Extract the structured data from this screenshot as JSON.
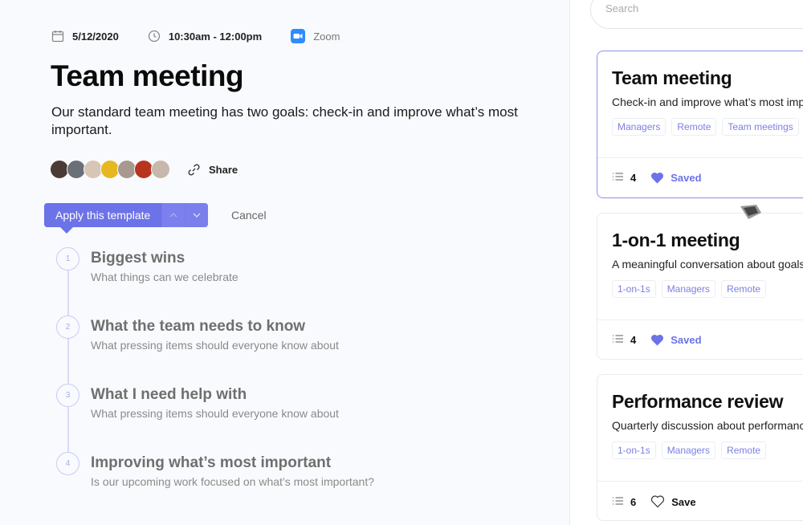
{
  "meeting": {
    "date": "5/12/2020",
    "time": "10:30am - 12:00pm",
    "platform": "Zoom",
    "title": "Team meeting",
    "description": "Our standard team meeting has two goals: check-in and improve what’s most important.",
    "share_label": "Share",
    "participants": [
      {
        "name": "participant-1",
        "color": "#4a3b35"
      },
      {
        "name": "participant-2",
        "color": "#6a6f78"
      },
      {
        "name": "participant-3",
        "color": "#d8c6b4"
      },
      {
        "name": "participant-4",
        "color": "#e6b820"
      },
      {
        "name": "participant-5",
        "color": "#a79890"
      },
      {
        "name": "participant-6",
        "color": "#b8341f"
      },
      {
        "name": "participant-7",
        "color": "#c7b8ad"
      }
    ]
  },
  "actions": {
    "apply_label": "Apply this template",
    "cancel_label": "Cancel"
  },
  "agenda": [
    {
      "number": "1",
      "title": "Biggest wins",
      "subtitle": "What things can we celebrate"
    },
    {
      "number": "2",
      "title": "What the team needs to know",
      "subtitle": "What pressing items should everyone know about"
    },
    {
      "number": "3",
      "title": "What I need help with",
      "subtitle": "What pressing items should everyone know about"
    },
    {
      "number": "4",
      "title": "Improving what’s most important",
      "subtitle": "Is our upcoming work focused on what’s most important?"
    }
  ],
  "sidebar": {
    "search_placeholder": "Search",
    "cards": [
      {
        "title": "Team meeting",
        "description": "Check-in and improve what’s most important",
        "tags": [
          "Managers",
          "Remote",
          "Team meetings"
        ],
        "item_count": "4",
        "save_label": "Saved",
        "saved": true,
        "selected": true
      },
      {
        "title": "1-on-1 meeting",
        "description": "A meaningful conversation about goals",
        "tags": [
          "1-on-1s",
          "Managers",
          "Remote"
        ],
        "item_count": "4",
        "save_label": "Saved",
        "saved": true,
        "selected": false
      },
      {
        "title": "Performance review",
        "description": "Quarterly discussion about performance",
        "tags": [
          "1-on-1s",
          "Managers",
          "Remote"
        ],
        "item_count": "6",
        "save_label": "Save",
        "saved": false,
        "selected": false
      }
    ]
  },
  "colors": {
    "accent": "#6c72e8",
    "background": "#f9fafd"
  }
}
